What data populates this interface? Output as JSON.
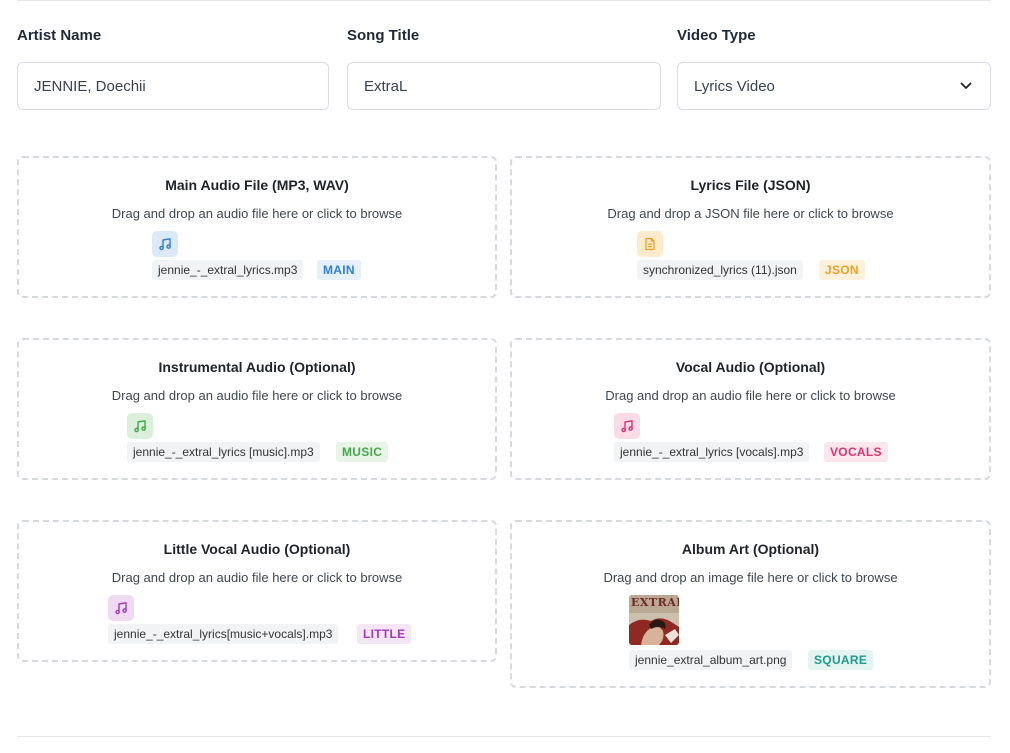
{
  "form": {
    "artist": {
      "label": "Artist Name",
      "value": "JENNIE, Doechii"
    },
    "song": {
      "label": "Song Title",
      "value": "ExtraL"
    },
    "video_type": {
      "label": "Video Type",
      "value": "Lyrics Video"
    }
  },
  "uploads": {
    "main_audio": {
      "title": "Main Audio File (MP3, WAV)",
      "hint": "Drag and drop an audio file here or click to browse",
      "file": "jennie_-_extral_lyrics.mp3",
      "badge": "MAIN",
      "icon": "music-note-icon",
      "color": "#2f7fd1"
    },
    "lyrics_file": {
      "title": "Lyrics File (JSON)",
      "hint": "Drag and drop a JSON file here or click to browse",
      "file": "synchronized_lyrics (11).json",
      "badge": "JSON",
      "icon": "document-icon",
      "color": "#f0a020"
    },
    "instrumental": {
      "title": "Instrumental Audio (Optional)",
      "hint": "Drag and drop an audio file here or click to browse",
      "file": "jennie_-_extral_lyrics [music].mp3",
      "badge": "MUSIC",
      "icon": "music-note-icon",
      "color": "#43a84a"
    },
    "vocal": {
      "title": "Vocal Audio (Optional)",
      "hint": "Drag and drop an audio file here or click to browse",
      "file": "jennie_-_extral_lyrics [vocals].mp3",
      "badge": "VOCALS",
      "icon": "music-note-icon",
      "color": "#e0336e"
    },
    "little_vocal": {
      "title": "Little Vocal Audio (Optional)",
      "hint": "Drag and drop an audio file here or click to browse",
      "file": "jennie_-_extral_lyrics[music+vocals].mp3",
      "badge": "LITTLE",
      "icon": "music-note-icon",
      "color": "#a03cb8"
    },
    "album_art": {
      "title": "Album Art (Optional)",
      "hint": "Drag and drop an image file here or click to browse",
      "file": "jennie_extral_album_art.png",
      "badge": "SQUARE",
      "icon": "album-art-thumbnail",
      "thumb_text": "EXTRAL",
      "color": "#1f9a8c"
    }
  }
}
